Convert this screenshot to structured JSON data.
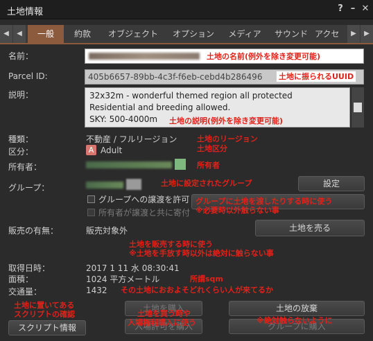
{
  "window": {
    "title": "土地情報",
    "help_icon": "?",
    "min_icon": "–",
    "close_icon": "✕"
  },
  "tabs": {
    "prev2": "◀",
    "prev": "◀",
    "items": [
      "一般",
      "約款",
      "オブジェクト",
      "オプション",
      "メディア",
      "サウンド",
      "アクセ"
    ],
    "next": "▶",
    "next2": "▶"
  },
  "fields": {
    "name_label": "名前：",
    "parcel_label": "Parcel ID:",
    "parcel_value": "405b6657-89bb-4c3f-f6eb-cebd4b286496",
    "desc_label": "説明：",
    "desc_line1": "32x32m - wonderful themed region all protected",
    "desc_line2": "Residential and breeding allowed.",
    "desc_line3": "SKY: 500-4000m",
    "type_label": "種類：",
    "type_value": "不動産 / フルリージョン",
    "rating_label": "区分：",
    "rating_badge": "A",
    "rating_value": "Adult",
    "owner_label": "所有者：",
    "group_label": "グループ：",
    "group_button": "設定",
    "cb_deed": "グループへの譲渡を許可",
    "cb_owner_contrib": "所有者が譲渡と共に寄付",
    "sale_label": "販売の有無：",
    "sale_value": "販売対象外",
    "sell_button": "土地を売る",
    "acquired_label": "取得日時：",
    "acquired_value": "2017 1 11 水 08:30:41",
    "area_label": "面積：",
    "area_value": "1024 平方メートル",
    "traffic_label": "交通量：",
    "traffic_value": "1432",
    "script_button": "スクリプト情報",
    "buy_button_partial": "土地を購入",
    "pass_button_partial": "入場許可を購入",
    "abandon_button": "土地の放棄",
    "reclaim_button_partial": "グループに購入"
  },
  "notes": {
    "name": "土地の名前(例外を除き変更可能)",
    "uuid": "土地に振られるUUID",
    "desc": "土地の説明(例外を除き変更可能)",
    "region": "土地のリージョン",
    "rating": "土地区分",
    "owner": "所有者",
    "group": "土地に設定されたグループ",
    "deed1": "グループに土地を渡したりする時に使う",
    "deed2": "※必要時以外触らない事",
    "sell1": "土地を販売する時に使う",
    "sell2": "※土地を手放す時以外は絶対に触らない事",
    "sqm": "所謂sqm",
    "traffic": "その土地におおよそどれくらい人が来てるか",
    "script1": "土地に置いてある",
    "script2": "スクリプトの確認",
    "buy1": "土地を買う時や",
    "buy2": "入場権利購入に使う",
    "abandon": "※絶対触らないように"
  },
  "colors": {
    "annotation": "#e0221a",
    "tab_active": "#8c5a3c",
    "rating_badge": "#d9776e"
  }
}
